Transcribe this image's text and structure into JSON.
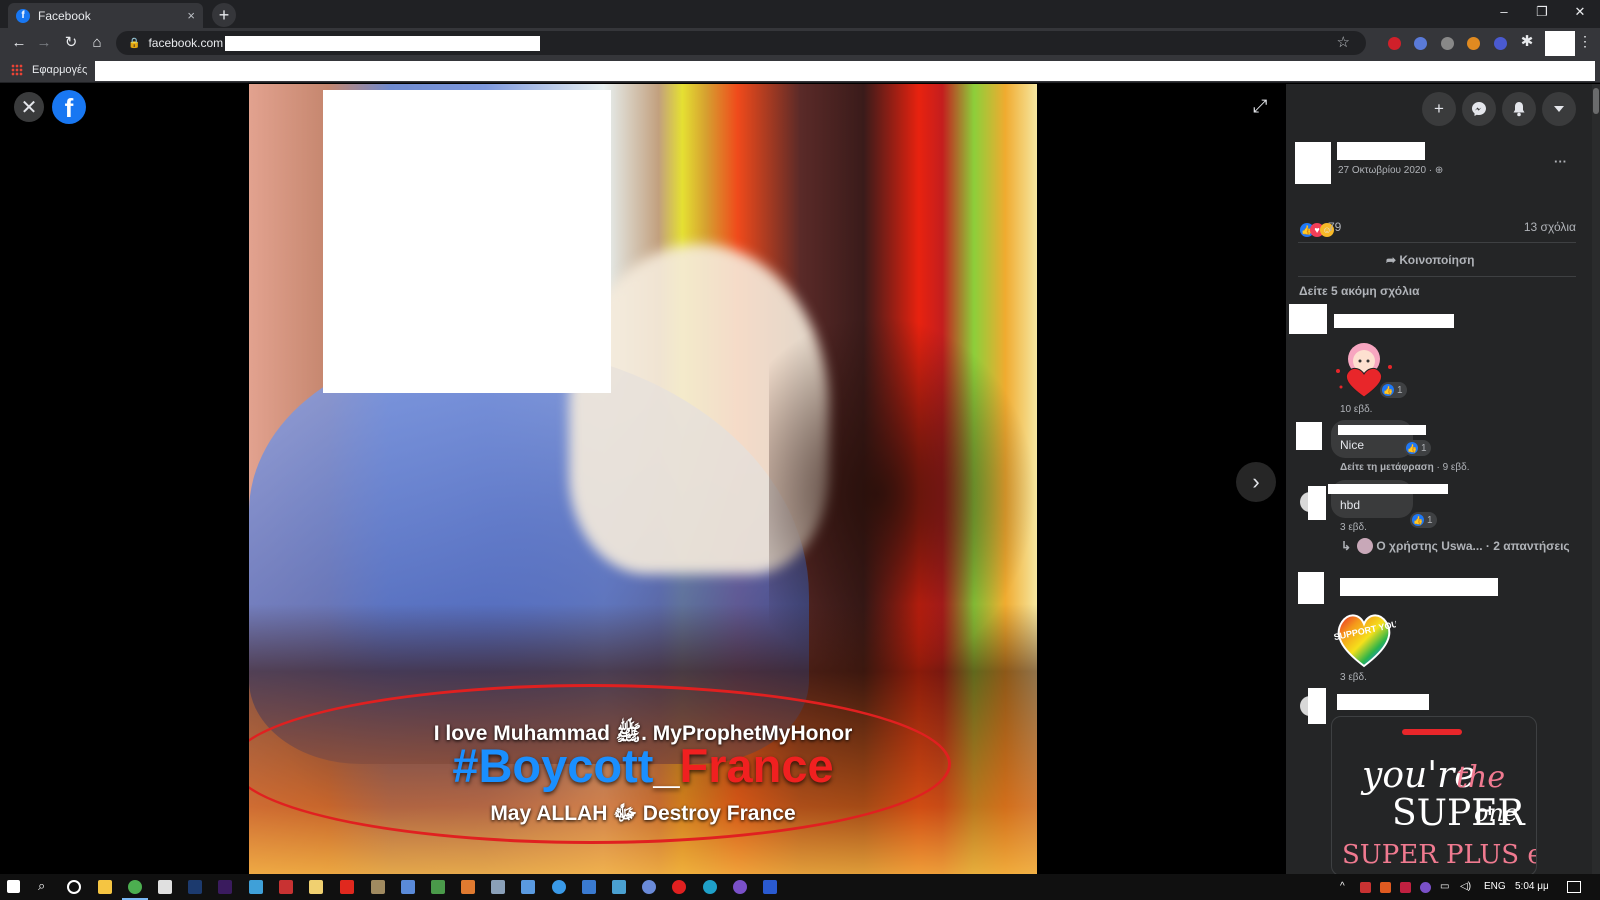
{
  "browser": {
    "tab_title": "Facebook",
    "tab_favicon": "f",
    "tab_close": "×",
    "new_tab": "+",
    "url": "facebook.com",
    "bookmarks_apps_label": "Εφαρμογές",
    "window_controls": [
      "–",
      "❐",
      "✕"
    ]
  },
  "viewer": {
    "close_icon": "✕",
    "logo": "f",
    "fullscreen_icon": "⤢",
    "next_icon": "›",
    "image_text": {
      "line1": "I love Muhammad ﷺ. MyProphetMyHonor",
      "line2_part1": "#Boycott",
      "line2_part2": "_",
      "line2_part3": "France",
      "line3": "May ALLAH ﷻ Destroy France"
    }
  },
  "panel": {
    "header_icons": [
      "+",
      "messenger-icon",
      "bell-icon",
      "caret-down-icon"
    ],
    "post": {
      "date": "27 Οκτωβρίου 2020 · ",
      "privacy_icon": "⊕",
      "more_icon": "···",
      "reactions_count": "79",
      "comments_count": "13 σχόλια",
      "share_label": "Κοινοποίηση",
      "see_more_comments": "Δείτε 5 ακόμη σχόλια"
    },
    "comments": [
      {
        "type": "sticker",
        "sticker": "heart-hug-sticker",
        "likes": "1",
        "time": "10 εβδ."
      },
      {
        "type": "text",
        "text": "Nice",
        "likes": "1",
        "translate": "Δείτε τη μετάφραση",
        "time": "9 εβδ."
      },
      {
        "type": "text",
        "text": "hbd",
        "likes": "1",
        "time": "3 εβδ.",
        "replies": "Ο χρήστης Uswa... · 2 απαντήσεις"
      },
      {
        "type": "sticker",
        "sticker": "i-support-you-sticker",
        "sticker_text": "I SUPPORT YOU",
        "time": "3 εβδ."
      },
      {
        "type": "sticker",
        "sticker": "super-one-sticker",
        "sticker_text_1": "you're",
        "sticker_text_2": "the",
        "sticker_text_3": "SUPER",
        "sticker_text_4": "one",
        "sticker_text_5": "SUPER PLUS ever"
      }
    ]
  },
  "taskbar": {
    "lang": "ENG",
    "time": "5:04 μμ"
  },
  "colors": {
    "facebook_blue": "#1877f2",
    "panel_bg": "#242526",
    "like_blue": "#2078f4"
  }
}
